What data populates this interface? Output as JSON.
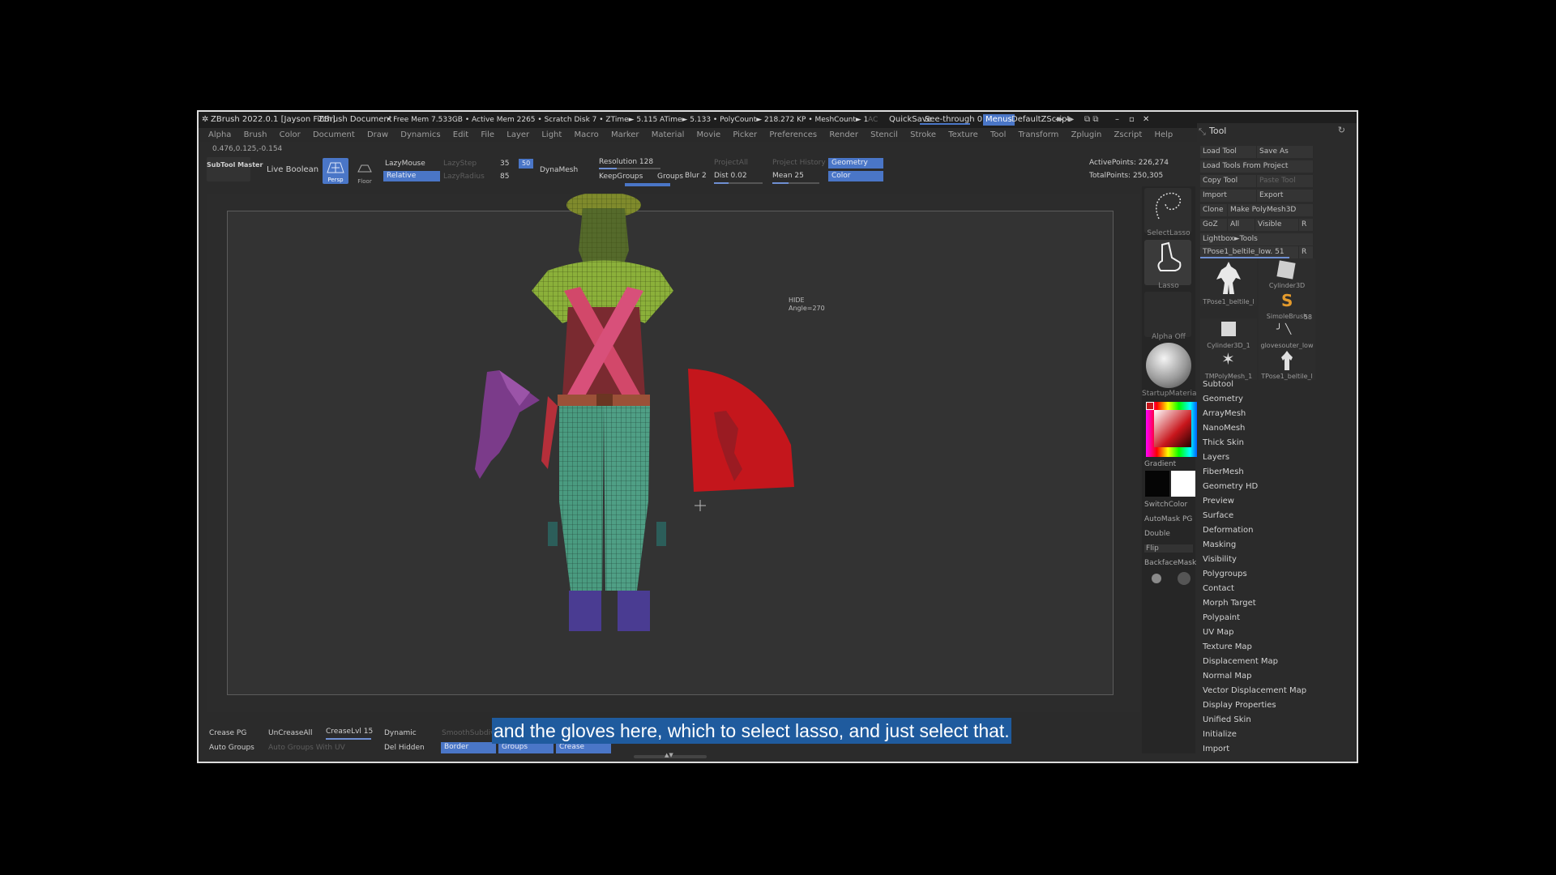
{
  "titlebar": {
    "app": "ZBrush 2022.0.1 [Jayson Fitch]",
    "document": "ZBrush Document",
    "stats": "• Free Mem 7.533GB • Active Mem 2265 • Scratch Disk 7 • ZTime► 5.115 ATime► 5.133 • PolyCount► 218.272 KP • MeshCount► 1",
    "ac": "AC",
    "quicksave": "QuickSave",
    "seethrough": "See-through 0",
    "menus": "Menus",
    "script": "DefaultZScript"
  },
  "menu": [
    "Alpha",
    "Brush",
    "Color",
    "Document",
    "Draw",
    "Dynamics",
    "Edit",
    "File",
    "Layer",
    "Light",
    "Macro",
    "Marker",
    "Material",
    "Movie",
    "Picker",
    "Preferences",
    "Render",
    "Stencil",
    "Stroke",
    "Texture",
    "Tool",
    "Transform",
    "Zplugin",
    "Zscript",
    "Help"
  ],
  "coords": "0.476,0.125,-0.154",
  "shelf": {
    "subtool_master": "SubTool Master",
    "live_boolean": "Live Boolean",
    "persp": "Persp",
    "floor": "Floor",
    "dynamic": "Dynamic",
    "lazymouse": "LazyMouse",
    "relative": "Relative",
    "lazystep": "LazyStep",
    "lazystep_val": "35",
    "lazysmooth_val": "50",
    "lazyradius": "LazyRadius",
    "lazyradius_val": "85",
    "dynamesh": "DynaMesh",
    "resolution": "Resolution 128",
    "keepgroups": "KeepGroups",
    "groups": "Groups",
    "blur": "Blur 2",
    "project_all": "ProjectAll",
    "dist": "Dist 0.02",
    "project_history": "Project History",
    "mean": "Mean 25",
    "geometry": "Geometry",
    "color": "Color",
    "active_points": "ActivePoints: 226,274",
    "total_points": "TotalPoints: 250,305"
  },
  "viewport": {
    "hide_label": "HIDE",
    "angle_label": "Angle=270"
  },
  "right_tools": {
    "select_lasso": "SelectLasso",
    "lasso": "Lasso",
    "alpha_off": "Alpha Off",
    "material": "StartupMaterial",
    "gradient": "Gradient",
    "switchcolor": "SwitchColor",
    "automask": "AutoMask PG",
    "double": "Double",
    "flip": "Flip",
    "backfacemask": "BackfaceMask"
  },
  "tool_panel": {
    "title": "Tool",
    "load_tool": "Load Tool",
    "save_as": "Save As",
    "load_from_project": "Load Tools From Project",
    "copy_tool": "Copy Tool",
    "paste_tool": "Paste Tool",
    "import": "Import",
    "export": "Export",
    "clone": "Clone",
    "make_polymesh": "Make PolyMesh3D",
    "goz": "GoZ",
    "all": "All",
    "visible": "Visible",
    "r": "R",
    "lightbox": "Lightbox►Tools",
    "current_tool": "TPose1_beltile_low. 51",
    "current_r": "R",
    "thumbs": [
      "TPose1_beltile_l",
      "Cylinder3D",
      "SimpleBrush",
      "Cylinder3D_1",
      "glovesouter_low",
      "TMPolyMesh_1",
      "TPose1_beltile_l"
    ],
    "thumb_count": "58",
    "submenu": [
      "Subtool",
      "Geometry",
      "ArrayMesh",
      "NanoMesh",
      "Thick Skin",
      "Layers",
      "FiberMesh",
      "Geometry HD",
      "Preview",
      "Surface",
      "Deformation",
      "Masking",
      "Visibility",
      "Polygroups",
      "Contact",
      "Morph Target",
      "Polypaint",
      "UV Map",
      "Texture Map",
      "Displacement Map",
      "Normal Map",
      "Vector Displacement Map",
      "Display Properties",
      "Unified Skin",
      "Initialize",
      "Import"
    ]
  },
  "bottom": {
    "crease_pg": "Crease PG",
    "uncrease_all": "UnCreaseAll",
    "crease_lvl": "CreaseLvl 15",
    "dynamic": "Dynamic",
    "smooth_subdiv": "SmoothSubdiv",
    "auto_groups": "Auto Groups",
    "auto_groups_uv": "Auto Groups With UV",
    "del_hidden": "Del Hidden",
    "border": "Border",
    "groups": "Groups",
    "crease": "Crease"
  },
  "subtitle": "and the gloves here, which to select lasso, and just select that.",
  "colors": {
    "accent": "#4a76c7",
    "selection_red": "#c4161c",
    "subtitle_bg": "#1f5b9e"
  }
}
